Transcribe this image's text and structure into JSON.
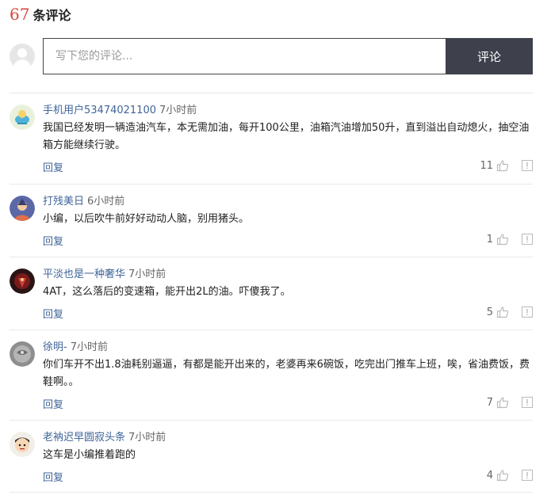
{
  "header": {
    "count": "67",
    "label": "条评论"
  },
  "composer": {
    "placeholder": "写下您的评论...",
    "submit_label": "评论"
  },
  "comments": [
    {
      "user": "手机用户53474021100",
      "time": "7小时前",
      "text": "我国已经发明一辆造油汽车，本无需加油，每开100公里，油箱汽油增加50升，直到溢出自动熄火，抽空油箱方能继续行驶。",
      "reply": "回复",
      "likes": "11"
    },
    {
      "user": "打残美日",
      "time": "6小时前",
      "text": "小编，以后吹牛前好好动动人脑，别用猪头。",
      "reply": "回复",
      "likes": "1"
    },
    {
      "user": "平淡也是一种奢华",
      "time": "7小时前",
      "text": "4AT，这么落后的变速箱，能开出2L的油。吓傻我了。",
      "reply": "回复",
      "likes": "5"
    },
    {
      "user": "徐明-",
      "time": "7小时前",
      "text": "你们车开不出1.8油耗别逼逼，有都是能开出来的，老婆再来6碗饭，吃完出门推车上班，唉，省油费饭，费鞋啊。。",
      "reply": "回复",
      "likes": "7"
    },
    {
      "user": "老衲迟早圆寂头条",
      "time": "7小时前",
      "text": "这车是小编推着跑的",
      "reply": "回复",
      "likes": "4"
    }
  ]
}
